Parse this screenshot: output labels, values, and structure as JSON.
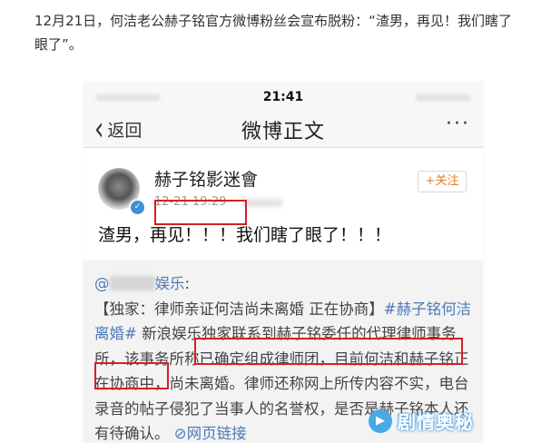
{
  "caption": {
    "text": "12月21日，何洁老公赫子铭官方微博粉丝会宣布脱粉：“渣男，再见！我们瞎了眼了”。"
  },
  "status_bar": {
    "time": "21:41"
  },
  "navbar": {
    "back_label": "返回",
    "title": "微博正文",
    "more_label": "···"
  },
  "post": {
    "username": "赫子铭影迷會",
    "timestamp": "12-21 19:29",
    "follow_label": "+关注",
    "text": "渣男，再见！！！我们瞎了眼了！！！"
  },
  "repost": {
    "mention_prefix": "@",
    "mention_suffix": "娱乐",
    "colon": ":",
    "body_1": "【独家：律师亲证何洁尚未离婚 正在协商】",
    "topic": "#赫子铭何洁离婚#",
    "body_2": " 新浪娱乐独家联系到赫子铭委任的代理律师事务所，该事务所称已确定组成律师团，",
    "highlight": "目前何洁和赫子铭正在协商中，尚未离婚。",
    "body_3": "律师还称网上所传内容不实，电台录音的帖子侵犯了当事人的名誉权，是否是赫子铭本人还有待确认。",
    "link_label": "网页链接",
    "link_icon": "link-icon"
  },
  "watermark": {
    "text": "剧情奥秘"
  },
  "colors": {
    "highlight_border": "#d62020",
    "link": "#4d7ab5",
    "follow": "#e0802a"
  }
}
